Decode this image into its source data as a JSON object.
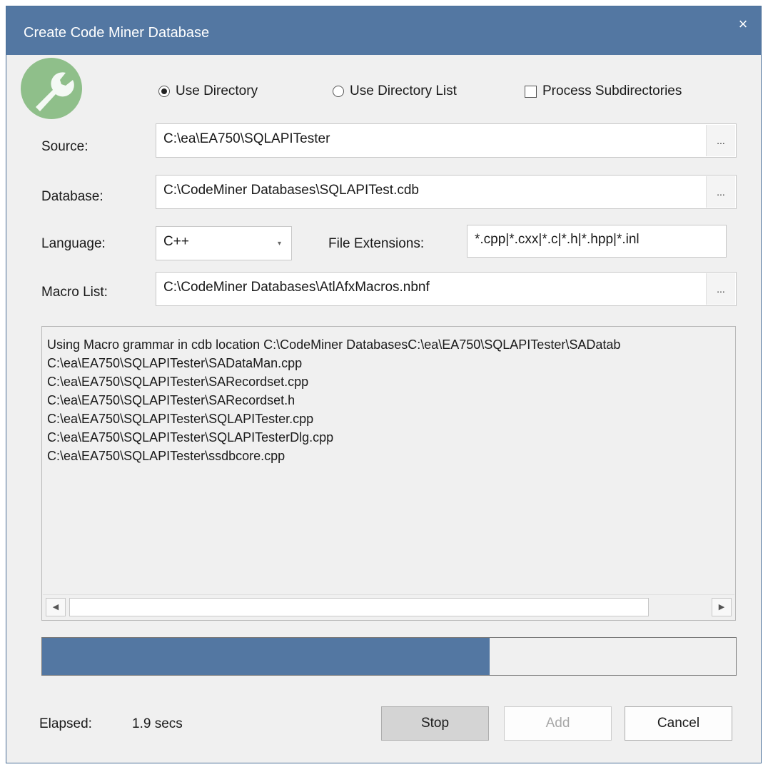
{
  "window": {
    "title": "Create Code Miner Database",
    "close_icon": "×"
  },
  "options": {
    "use_directory": "Use Directory",
    "use_directory_list": "Use Directory List",
    "process_subdirectories": "Process Subdirectories",
    "selected": "use_directory",
    "process_subdirectories_checked": false
  },
  "source": {
    "label": "Source:",
    "value": "C:\\ea\\EA750\\SQLAPITester",
    "browse": "..."
  },
  "database": {
    "label": "Database:",
    "value": "C:\\CodeMiner Databases\\SQLAPITest.cdb",
    "browse": "..."
  },
  "language": {
    "label": "Language:",
    "value": "C++",
    "arrow": "▾"
  },
  "file_extensions": {
    "label": "File Extensions:",
    "value": "*.cpp|*.cxx|*.c|*.h|*.hpp|*.inl"
  },
  "macro_list": {
    "label": "Macro List:",
    "value": "C:\\CodeMiner Databases\\AtlAfxMacros.nbnf",
    "browse": "..."
  },
  "log": {
    "lines": [
      "Using Macro grammar in cdb location C:\\CodeMiner DatabasesC:\\ea\\EA750\\SQLAPITester\\SADatab",
      "C:\\ea\\EA750\\SQLAPITester\\SADataMan.cpp",
      "C:\\ea\\EA750\\SQLAPITester\\SARecordset.cpp",
      "C:\\ea\\EA750\\SQLAPITester\\SARecordset.h",
      "C:\\ea\\EA750\\SQLAPITester\\SQLAPITester.cpp",
      "C:\\ea\\EA750\\SQLAPITester\\SQLAPITesterDlg.cpp",
      "C:\\ea\\EA750\\SQLAPITester\\ssdbcore.cpp"
    ],
    "scroll_left": "◀",
    "scroll_right": "▶"
  },
  "progress": {
    "fraction": 0.645,
    "fill_color": "#5377a2"
  },
  "elapsed": {
    "label": "Elapsed:",
    "value": "1.9 secs"
  },
  "buttons": {
    "stop": "Stop",
    "add": "Add",
    "cancel": "Cancel"
  },
  "colors": {
    "titlebar": "#5377a2",
    "icon_circle": "#8fbf8a"
  }
}
